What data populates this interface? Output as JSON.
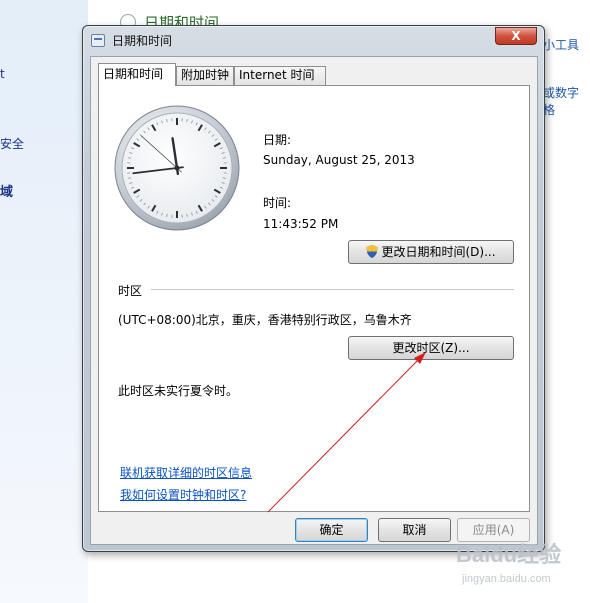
{
  "background": {
    "left_items": [
      "t",
      "安全",
      "域"
    ],
    "top_title": "日期和时间",
    "right_links": [
      "小工具",
      "或数字格"
    ]
  },
  "window": {
    "title": "日期和时间",
    "close_label": "X"
  },
  "tabs": [
    {
      "label": "日期和时间",
      "active": true
    },
    {
      "label": "附加时钟",
      "active": false
    },
    {
      "label": "Internet 时间",
      "active": false
    }
  ],
  "datetime": {
    "date_label": "日期:",
    "date_value": "Sunday, August 25, 2013",
    "time_label": "时间:",
    "time_value": "11:43:52 PM",
    "clock": {
      "hour": 11,
      "minute": 43,
      "second": 52
    },
    "change_button": "更改日期和时间(D)..."
  },
  "timezone": {
    "header": "时区",
    "value": "(UTC+08:00)北京，重庆，香港特别行政区，乌鲁木齐",
    "change_button": "更改时区(Z)...",
    "dst_note": "此时区未实行夏令时。"
  },
  "links": {
    "online_info": "联机获取详细的时区信息",
    "how_to": "我如何设置时钟和时区?"
  },
  "footer": {
    "ok": "确定",
    "cancel": "取消",
    "apply": "应用(A)"
  },
  "watermark": {
    "brand": "Baidu经验",
    "url": "jingyan.baidu.com"
  },
  "colors": {
    "link": "#0a52c4",
    "annotation_arrow": "#d41e1e",
    "close_button": "#c8432f"
  }
}
